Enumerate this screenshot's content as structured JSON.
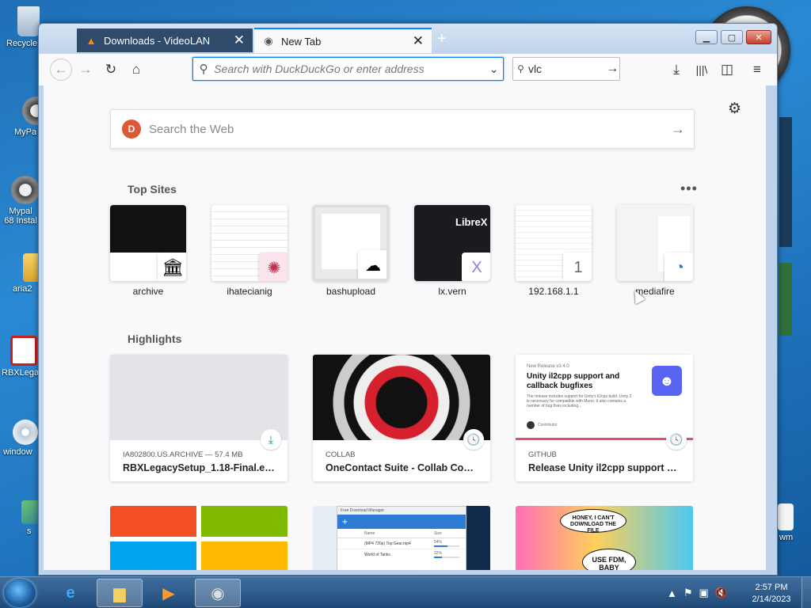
{
  "desktop": {
    "icons": [
      {
        "label": "Recycle"
      },
      {
        "label": "MyPa"
      },
      {
        "label": "Mypal 68 Instal"
      },
      {
        "label": "aria2"
      },
      {
        "label": "RBXLega"
      },
      {
        "label": "window"
      },
      {
        "label": "s"
      },
      {
        "label": "wm"
      }
    ]
  },
  "browser": {
    "tabs": [
      {
        "title": "Downloads - VideoLAN",
        "icon": "vlc-cone-icon"
      },
      {
        "title": "New Tab",
        "icon": "mypal-raccoon-icon"
      }
    ],
    "url_placeholder": "Search with DuckDuckGo or enter address",
    "search_value": "vlc",
    "new_tab": {
      "websearch_placeholder": "Search the Web",
      "top_sites_title": "Top Sites",
      "top_sites": [
        {
          "label": "archive"
        },
        {
          "label": "ihatecianig"
        },
        {
          "label": "bashupload"
        },
        {
          "label": "lx.vern"
        },
        {
          "label": "192.168.1.1",
          "badge_text": "1"
        },
        {
          "label": "mediafire"
        }
      ],
      "highlights_title": "Highlights",
      "highlights": [
        {
          "meta": "IA802800.US.ARCHIVE — 57.4 MB",
          "title": "RBXLegacySetup_1.18-Final.exe",
          "badge": "download-icon"
        },
        {
          "meta": "COLLAB",
          "title": "OneContact Suite - Collab Conta...",
          "badge": "clock-icon"
        },
        {
          "meta": "GITHUB",
          "title": "Release Unity il2cpp support and...",
          "badge": "clock-icon"
        }
      ],
      "github_card": {
        "release": "New Release v3.4.0",
        "heading": "Unity il2cpp support and callback bugfixes",
        "body": "The release includes support for Unity's il2cpp build. Unity 2 is necessary for compatible with Mono. It also contains a number of bug fixes including...",
        "author": "Contributor"
      },
      "librex_text": "LibreX",
      "fdm_card": {
        "window_title": "Free Download Manager",
        "col_name": "Name",
        "col_size": "Size",
        "row1": "(MP4 720p) Top Gear.mp4",
        "row1_pct": "54%",
        "row2": "World of Tanks",
        "row2_pct": "32%"
      },
      "comic_card": {
        "bubble1": "HONEY, I CAN'T DOWNLOAD THE FILE",
        "bubble2": "USE FDM, BABY"
      }
    }
  },
  "taskbar": {
    "time": "2:57 PM",
    "date": "2/14/2023"
  },
  "colors": {
    "accent": "#0a84ff",
    "ddg": "#de5833",
    "close": "#c4402a"
  }
}
